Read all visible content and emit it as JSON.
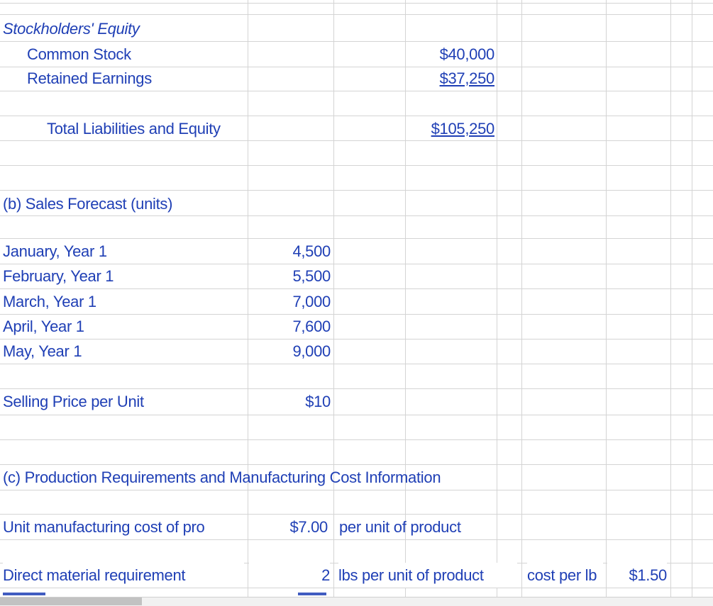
{
  "sheet": {
    "stockholders_equity_label": "Stockholders' Equity",
    "common_stock_label": "Common Stock",
    "common_stock_value": "$40,000",
    "retained_earnings_label": "Retained Earnings",
    "retained_earnings_value": "$37,250",
    "total_liab_equity_label": "Total Liabilities and Equity",
    "total_liab_equity_value": "$105,250",
    "sales_forecast_heading": "(b) Sales Forecast (units)",
    "forecast": [
      {
        "month": "January, Year 1",
        "units": "4,500"
      },
      {
        "month": "February, Year 1",
        "units": "5,500"
      },
      {
        "month": "March,  Year 1",
        "units": "7,000"
      },
      {
        "month": "April, Year 1",
        "units": "7,600"
      },
      {
        "month": "May,  Year 1",
        "units": "9,000"
      }
    ],
    "selling_price_label": "Selling Price per Unit",
    "selling_price_value": "$10",
    "production_heading": "(c) Production Requirements and Manufacturing Cost Information",
    "unit_mfg_cost_label": "Unit manufacturing cost of pro",
    "unit_mfg_cost_value": "$7.00",
    "unit_mfg_cost_unit": "per unit of product",
    "direct_material_label": "Direct material requirement",
    "direct_material_value": "2",
    "direct_material_unit": "lbs per unit of product",
    "cost_per_lb_label": "cost per lb",
    "cost_per_lb_value": "$1.50"
  }
}
